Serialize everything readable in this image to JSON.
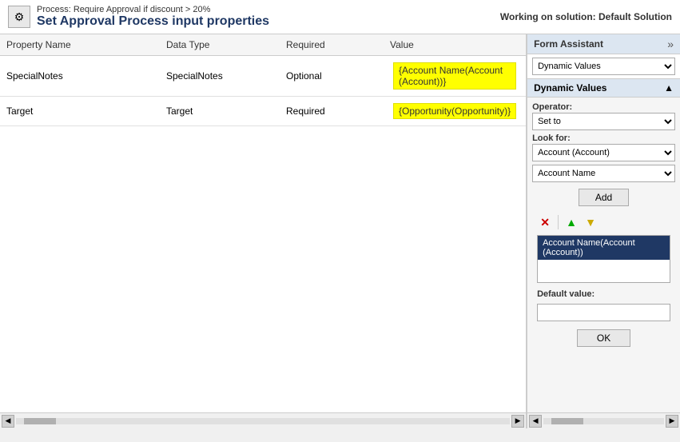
{
  "topBar": {
    "processLabel": "Process: Require Approval if discount > 20%",
    "pageTitle": "Set Approval Process input properties",
    "solutionLabel": "Working on solution: Default Solution",
    "icon": "⚙"
  },
  "table": {
    "columns": [
      "Property Name",
      "Data Type",
      "Required",
      "Value"
    ],
    "rows": [
      {
        "propertyName": "SpecialNotes",
        "dataType": "SpecialNotes",
        "required": "Optional",
        "value": "{Account Name(Account (Account))}"
      },
      {
        "propertyName": "Target",
        "dataType": "Target",
        "required": "Required",
        "value": "{Opportunity(Opportunity)}"
      }
    ]
  },
  "rightPanel": {
    "formAssistantTitle": "Form Assistant",
    "expandIcon": "»",
    "dynamicValuesDropdown": "Dynamic Values",
    "dynamicValuesSectionTitle": "Dynamic Values",
    "collapseIcon": "▲",
    "operatorLabel": "Operator:",
    "operatorValue": "Set to",
    "lookForLabel": "Look for:",
    "lookForValue": "Account (Account)",
    "fieldValue": "Account Name",
    "addButtonLabel": "Add",
    "deleteIcon": "✕",
    "upIcon": "▲",
    "downIcon": "▼",
    "listItem": "Account Name(Account (Account))",
    "defaultValueLabel": "Default value:",
    "defaultValuePlaceholder": "",
    "okButtonLabel": "OK"
  }
}
